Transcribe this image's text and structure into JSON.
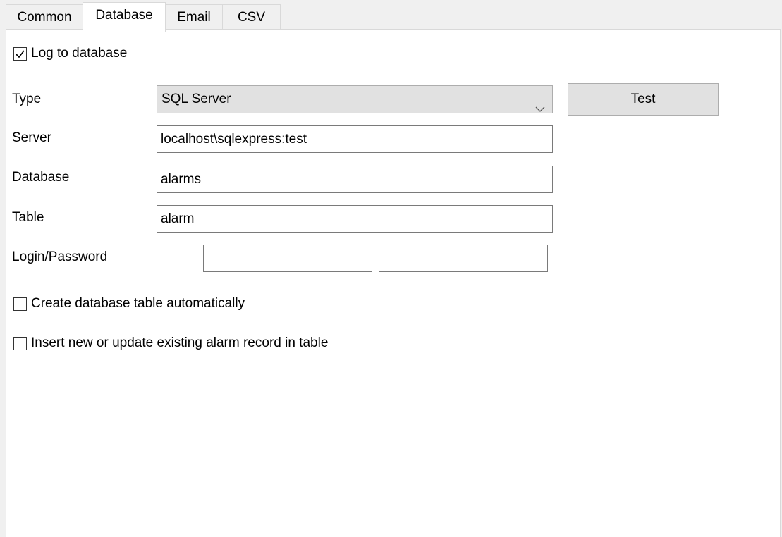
{
  "tabs": [
    {
      "label": "Common"
    },
    {
      "label": "Database"
    },
    {
      "label": "Email"
    },
    {
      "label": "CSV"
    }
  ],
  "active_tab": "Database",
  "form": {
    "log_to_db": {
      "label": "Log to database",
      "checked": true
    },
    "type": {
      "label": "Type",
      "value": "SQL Server",
      "icon": "chevron-down-icon"
    },
    "test_button": {
      "label": "Test"
    },
    "server": {
      "label": "Server",
      "value": "localhost\\sqlexpress:test"
    },
    "database": {
      "label": "Database",
      "value": "alarms"
    },
    "table": {
      "label": "Table",
      "value": "alarm"
    },
    "login_password": {
      "label": "Login/Password",
      "login": "",
      "password": ""
    },
    "create_table": {
      "label": "Create database table automatically",
      "checked": false
    },
    "insert_update": {
      "label": "Insert new or update existing alarm record in table",
      "checked": false
    }
  },
  "colors": {
    "window_bg": "#f0f0f0",
    "panel_bg": "#ffffff",
    "control_bg": "#e1e1e1",
    "border": "#7a7a7a"
  }
}
